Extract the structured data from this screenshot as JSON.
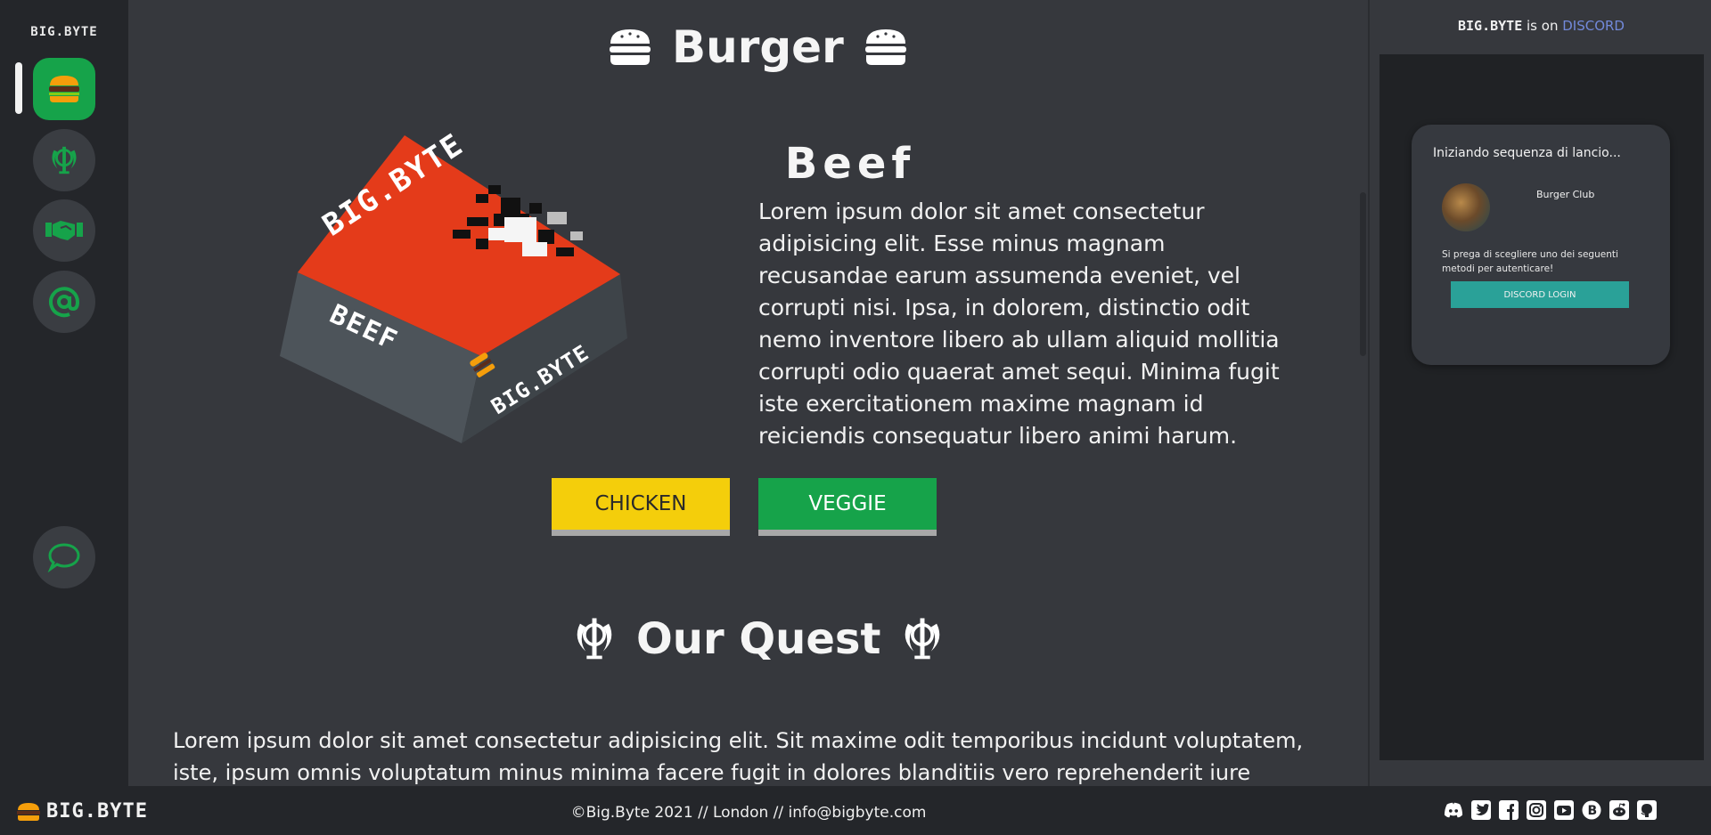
{
  "sidebar": {
    "logo": "BIG.BYTE",
    "items": [
      {
        "icon": "burger-icon",
        "active": true
      },
      {
        "icon": "khanda-icon",
        "active": false
      },
      {
        "icon": "handshake-icon",
        "active": false
      },
      {
        "icon": "at-sign-icon",
        "active": false
      }
    ],
    "chat_icon": "chat-bubble-icon"
  },
  "main": {
    "burger_section": {
      "title": "Burger",
      "product_name": "Beef",
      "description": "Lorem ipsum dolor sit amet consectetur adipisicing elit. Esse minus magnam recusandae earum assumenda eveniet, vel corrupti nisi. Ipsa, in dolorem, distinctio odit nemo inventore libero ab ullam aliquid mollitia corrupti odio quaerat amet sequi. Minima fugit iste exercitationem maxime magnam id reiciendis consequatur libero animi harum.",
      "buttons": {
        "chicken": "CHICKEN",
        "veggie": "VEGGIE"
      },
      "box_labels": {
        "brand": "BIG.BYTE",
        "side": "BEEF"
      }
    },
    "quest_section": {
      "title": "Our Quest",
      "text": "Lorem ipsum dolor sit amet consectetur adipisicing elit. Sit maxime odit temporibus incidunt voluptatem, iste, ipsum omnis voluptatum minus minima facere fugit in dolores blanditiis vero reprehenderit iure veniam quia"
    }
  },
  "right_panel": {
    "header": {
      "brand": "BIG.BYTE",
      "middle": " is on ",
      "link": "DISCORD"
    },
    "card": {
      "heading": "Iniziando sequenza di lancio...",
      "server_name": "Burger Club",
      "description": "Si prega di scegliere uno dei seguenti metodi per autenticare!",
      "login_button": "DISCORD LOGIN"
    }
  },
  "footer": {
    "logo": "BIG.BYTE",
    "center": "©Big.Byte 2021 // London // info@bigbyte.com",
    "social_icons": [
      "discord-icon",
      "twitter-icon",
      "facebook-icon",
      "instagram-icon",
      "youtube-icon",
      "bitcoin-icon",
      "reddit-icon",
      "github-icon"
    ]
  },
  "colors": {
    "accent_green": "#16a34a",
    "chicken_yellow": "#f4ce0b",
    "discord_link": "#7289da",
    "login_teal": "#2aa198"
  }
}
